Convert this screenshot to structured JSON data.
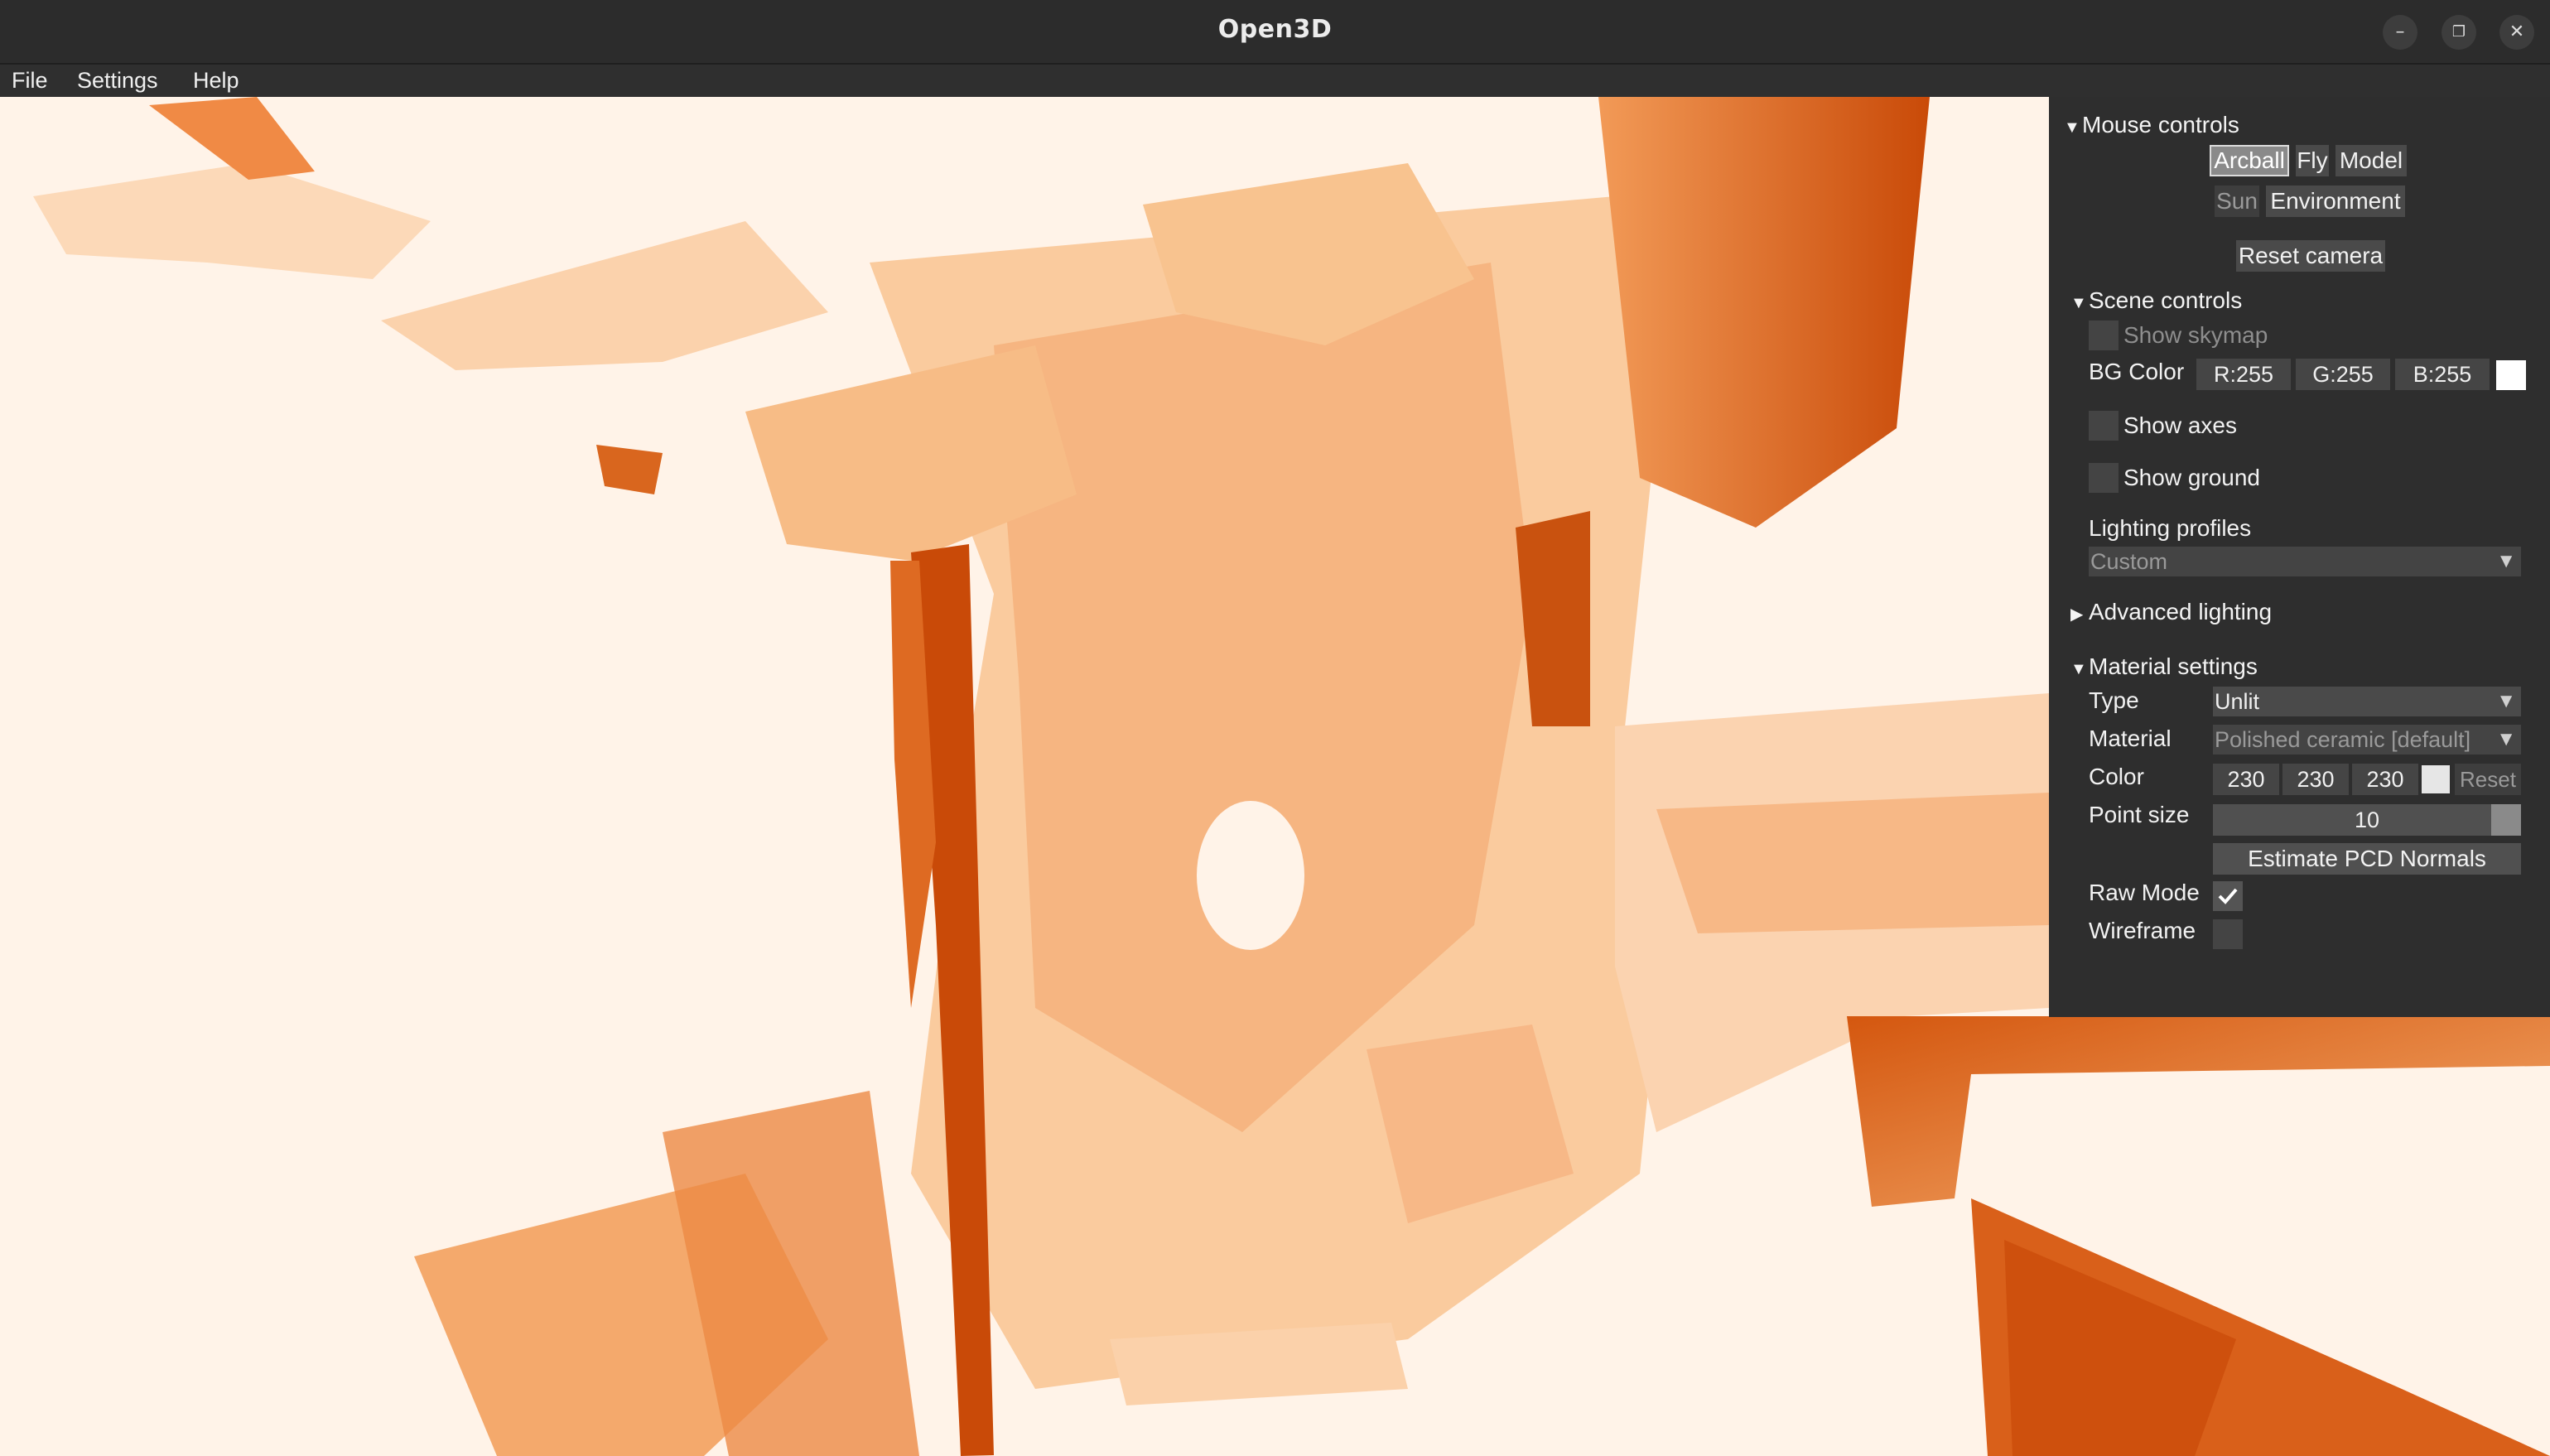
{
  "window": {
    "title": "Open3D",
    "controls": {
      "minimize": "–",
      "maximize": "❐",
      "close": "✕"
    }
  },
  "menu": {
    "file": "File",
    "settings": "Settings",
    "help": "Help"
  },
  "panel": {
    "mouse_controls": {
      "header": "Mouse controls",
      "arcball": "Arcball",
      "fly": "Fly",
      "model": "Model",
      "sun": "Sun",
      "environment": "Environment",
      "reset_camera": "Reset camera",
      "selected": "Arcball"
    },
    "scene_controls": {
      "header": "Scene controls",
      "show_skymap": "Show skymap",
      "bg_color_label": "BG Color",
      "bg_r": "R:255",
      "bg_g": "G:255",
      "bg_b": "B:255",
      "bg_swatch": "#ffffff",
      "show_axes": "Show axes",
      "show_ground": "Show ground",
      "lighting_profiles": "Lighting profiles",
      "lighting_value": "Custom"
    },
    "advanced_lighting": {
      "header": "Advanced lighting"
    },
    "material_settings": {
      "header": "Material settings",
      "type_label": "Type",
      "type_value": "Unlit",
      "material_label": "Material",
      "material_value": "Polished ceramic [default]",
      "color_label": "Color",
      "color_r": "230",
      "color_g": "230",
      "color_b": "230",
      "reset": "Reset",
      "point_size_label": "Point size",
      "point_size_value": "10",
      "estimate_normals": "Estimate PCD Normals",
      "raw_mode_label": "Raw Mode",
      "raw_mode_checked": true,
      "wireframe_label": "Wireframe",
      "wireframe_checked": false
    }
  },
  "colors": {
    "viewport_bg": "#fff3e8",
    "point_light": "#f9c28f",
    "point_mid": "#f29a57",
    "point_dark": "#c94a08",
    "panel_bg": "#2e2e2e"
  }
}
